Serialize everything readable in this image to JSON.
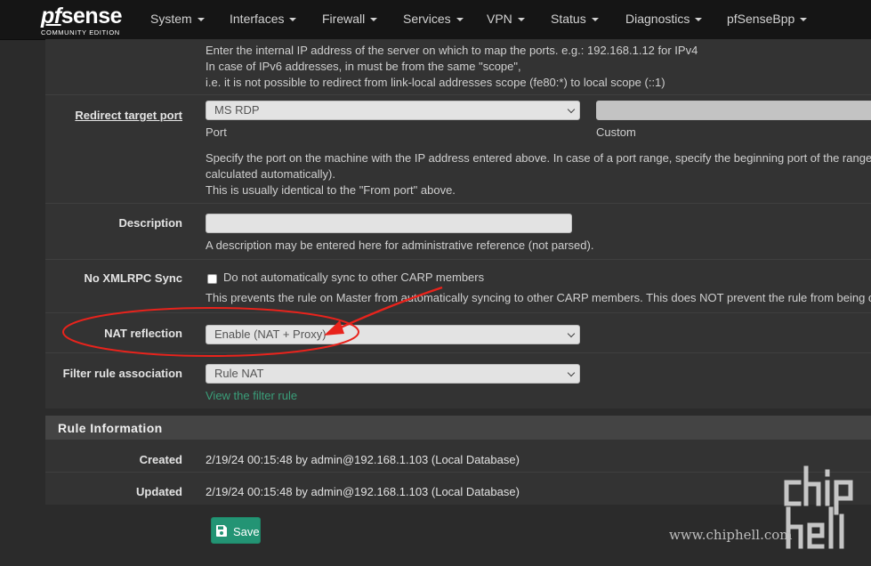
{
  "navbar": {
    "logo_prefix": "pf",
    "logo_main": "sense",
    "logo_sub": "COMMUNITY EDITION",
    "menu": [
      "System",
      "Interfaces",
      "Firewall",
      "Services",
      "VPN",
      "Status",
      "Diagnostics",
      "pfSenseBpp"
    ]
  },
  "redirect_ip_help": {
    "line1": "Enter the internal IP address of the server on which to map the ports. e.g.: 192.168.1.12 for IPv4",
    "line2": "In case of IPv6 addresses, in must be from the same \"scope\",",
    "line3": "i.e. it is not possible to redirect from link-local addresses scope (fe80:*) to local scope (::1)"
  },
  "redirect_port": {
    "label": "Redirect target port",
    "port_value": "MS RDP",
    "port_caption": "Port",
    "custom_caption": "Custom",
    "help_line1": "Specify the port on the machine with the IP address entered above. In case of a port range, specify the beginning port of the range (th",
    "help_line2": "calculated automatically).",
    "help_line3": "This is usually identical to the \"From port\" above."
  },
  "description": {
    "label": "Description",
    "value": "",
    "help": "A description may be entered here for administrative reference (not parsed)."
  },
  "xmlrpc": {
    "label": "No XMLRPC Sync",
    "checkbox_label": "Do not automatically sync to other CARP members",
    "help": "This prevents the rule on Master from automatically syncing to other CARP members. This does NOT prevent the rule from being ove"
  },
  "nat_reflection": {
    "label": "NAT reflection",
    "value": "Enable (NAT + Proxy)"
  },
  "filter_rule": {
    "label": "Filter rule association",
    "value": "Rule NAT",
    "link": "View the filter rule"
  },
  "rule_info": {
    "title": "Rule Information",
    "created_label": "Created",
    "created_value": "2/19/24 00:15:48 by admin@192.168.1.103 (Local Database)",
    "updated_label": "Updated",
    "updated_value": "2/19/24 00:15:48 by admin@192.168.1.103 (Local Database)"
  },
  "save_button": {
    "label": "Save"
  },
  "watermark": {
    "logo": "chip hell",
    "url": "www.chiphell.com"
  },
  "colors": {
    "navbar_bg": "#151515",
    "panel_bg": "#333333",
    "page_bg": "#2b2b2b",
    "save_button": "#239474",
    "link_green": "#3a9e79",
    "annotation_red": "#e8231c"
  }
}
